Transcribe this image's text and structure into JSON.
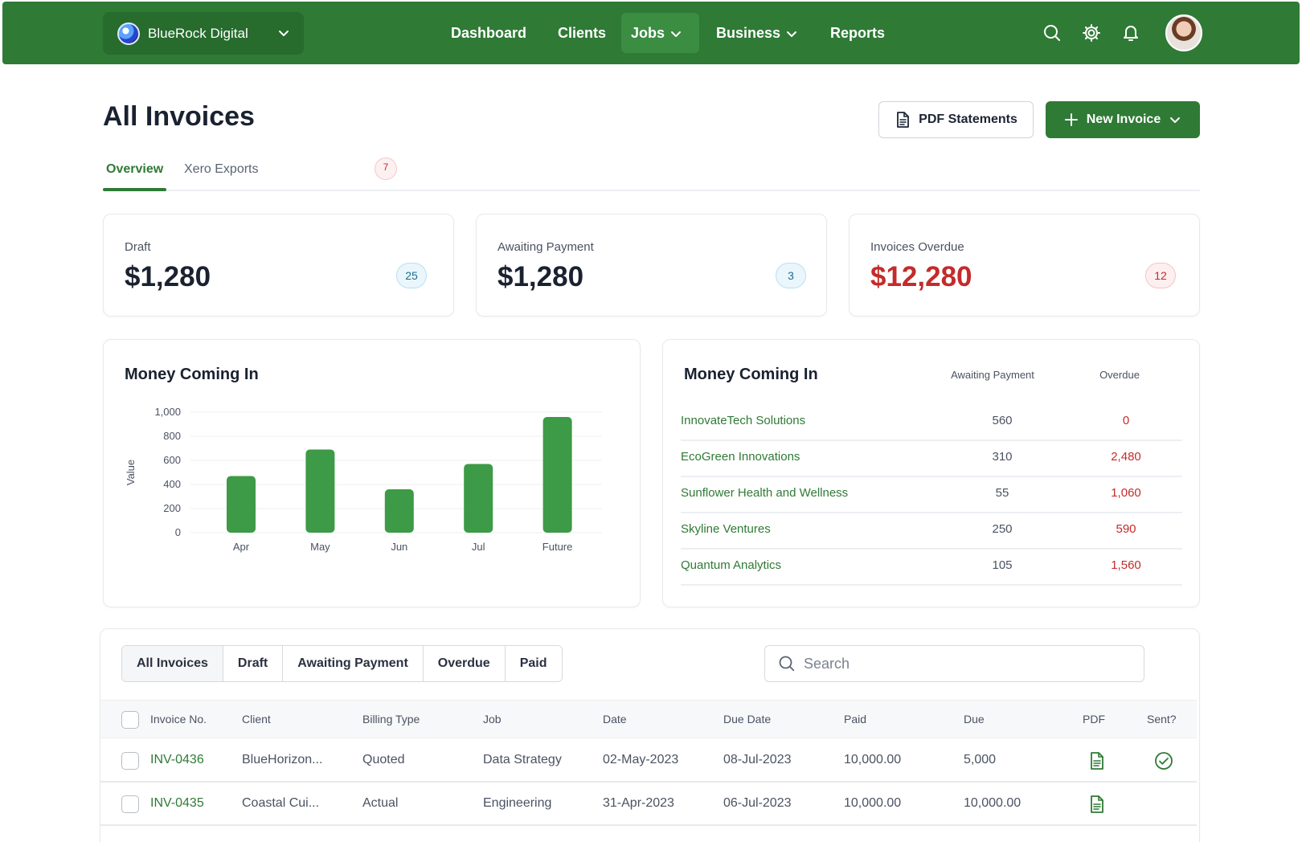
{
  "org": {
    "name": "BlueRock Digital"
  },
  "nav": {
    "dashboard": "Dashboard",
    "clients": "Clients",
    "jobs": "Jobs",
    "business": "Business",
    "reports": "Reports"
  },
  "page": {
    "title": "All Invoices",
    "pdf_button": "PDF Statements",
    "new_button": "New Invoice"
  },
  "tabs": {
    "overview": "Overview",
    "xero": "Xero Exports",
    "xero_count": "7"
  },
  "stats": [
    {
      "label": "Draft",
      "value": "$1,280",
      "count": "25"
    },
    {
      "label": "Awaiting Payment",
      "value": "$1,280",
      "count": "3"
    },
    {
      "label": "Invoices Overdue",
      "value": "$12,280",
      "count": "12"
    }
  ],
  "chart_panel": {
    "title": "Money Coming In"
  },
  "chart_data": {
    "type": "bar",
    "categories": [
      "Apr",
      "May",
      "Jun",
      "Jul",
      "Future"
    ],
    "values": [
      470,
      690,
      360,
      570,
      960
    ],
    "ylabel": "Value",
    "ylim": [
      0,
      1000
    ],
    "yticks": [
      "1,000",
      "800",
      "600",
      "400",
      "200",
      "0"
    ],
    "color": "#3d9a46",
    "grid": true
  },
  "money_table": {
    "title": "Money Coming In",
    "col_awaiting": "Awaiting Payment",
    "col_overdue": "Overdue",
    "rows": [
      {
        "client": "InnovateTech Solutions",
        "awaiting": "560",
        "overdue": "0"
      },
      {
        "client": "EcoGreen Innovations",
        "awaiting": "310",
        "overdue": "2,480"
      },
      {
        "client": "Sunflower Health and Wellness",
        "awaiting": "55",
        "overdue": "1,060"
      },
      {
        "client": "Skyline Ventures",
        "awaiting": "250",
        "overdue": "590"
      },
      {
        "client": "Quantum Analytics",
        "awaiting": "105",
        "overdue": "1,560"
      }
    ]
  },
  "filters": [
    "All Invoices",
    "Draft",
    "Awaiting Payment",
    "Overdue",
    "Paid"
  ],
  "search": {
    "placeholder": "Search"
  },
  "table": {
    "headers": {
      "invoice": "Invoice No.",
      "client": "Client",
      "billing": "Billing Type",
      "job": "Job",
      "date": "Date",
      "due_date": "Due Date",
      "paid": "Paid",
      "due": "Due",
      "pdf": "PDF",
      "sent": "Sent?"
    },
    "rows": [
      {
        "invoice": "INV-0436",
        "client": "BlueHorizon...",
        "billing": "Quoted",
        "job": "Data Strategy",
        "date": "02-May-2023",
        "due_date": "08-Jul-2023",
        "paid": "10,000.00",
        "due": "5,000",
        "sent": true
      },
      {
        "invoice": "INV-0435",
        "client": "Coastal Cui...",
        "billing": "Actual",
        "job": "Engineering",
        "date": "31-Apr-2023",
        "due_date": "06-Jul-2023",
        "paid": "10,000.00",
        "due": "10,000.00",
        "sent": false
      }
    ]
  },
  "colors": {
    "brand": "#2f7a35",
    "danger": "#c42b2b"
  },
  "icons": {
    "search": "search-icon",
    "settings": "gear-icon",
    "notifications": "bell-icon",
    "pdf": "document-icon",
    "sent": "check-circle-icon"
  }
}
